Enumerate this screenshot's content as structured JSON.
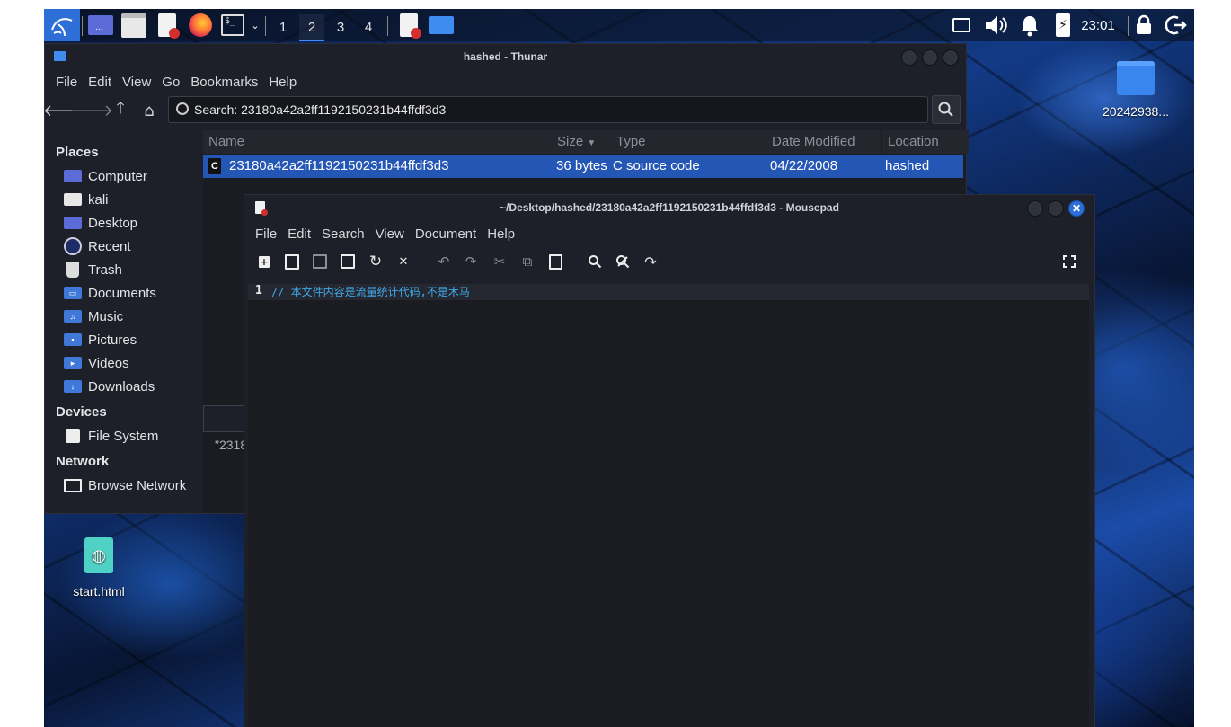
{
  "panel": {
    "workspaces": [
      "1",
      "2",
      "3",
      "4"
    ],
    "active_workspace": "2",
    "clock": "23:01"
  },
  "desktop_icons": {
    "top_folder": "20242938...",
    "start_file": "start.html"
  },
  "thunar": {
    "title": "hashed - Thunar",
    "menu": [
      "File",
      "Edit",
      "View",
      "Go",
      "Bookmarks",
      "Help"
    ],
    "search_text": "Search: 23180a42a2ff1192150231b44ffdf3d3",
    "sidebar": {
      "places_header": "Places",
      "places": [
        "Computer",
        "kali",
        "Desktop",
        "Recent",
        "Trash",
        "Documents",
        "Music",
        "Pictures",
        "Videos",
        "Downloads"
      ],
      "devices_header": "Devices",
      "devices": [
        "File System"
      ],
      "network_header": "Network",
      "network": [
        "Browse Network"
      ]
    },
    "columns": {
      "name": "Name",
      "size": "Size",
      "type": "Type",
      "date": "Date Modified",
      "location": "Location"
    },
    "rows": [
      {
        "icon": "C",
        "name": "23180a42a2ff1192150231b44ffdf3d3",
        "size": "36 bytes",
        "type": "C source code",
        "date": "04/22/2008",
        "location": "hashed"
      }
    ],
    "status_text": "\"2318"
  },
  "mousepad": {
    "title": "~/Desktop/hashed/23180a42a2ff1192150231b44ffdf3d3 - Mousepad",
    "menu": [
      "File",
      "Edit",
      "Search",
      "View",
      "Document",
      "Help"
    ],
    "line_number": "1",
    "code_line": "// 本文件内容是流量统计代码,不是木马"
  },
  "colors": {
    "accent": "#2456b5",
    "window_bg": "#1d2028",
    "code_comment": "#3fa7e8"
  }
}
